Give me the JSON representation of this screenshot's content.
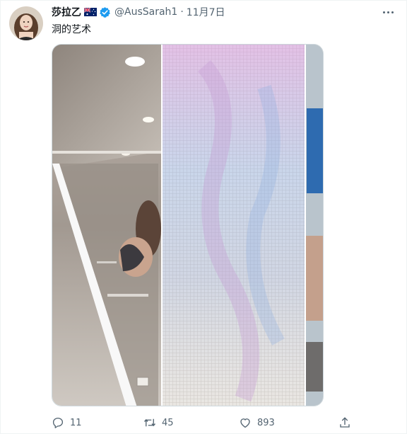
{
  "tweet": {
    "author_name": "莎拉乙",
    "handle": "@AusSarah1",
    "separator": "·",
    "timestamp": "11月7日",
    "text": "洞的艺术"
  },
  "icons": {
    "flag": "australia-flag-icon",
    "verified": "verified-badge-icon",
    "more": "more-icon",
    "reply": "reply-icon",
    "retweet": "retweet-icon",
    "like": "like-icon",
    "share": "share-icon"
  },
  "actions": {
    "reply_count": "11",
    "retweet_count": "45",
    "like_count": "893"
  },
  "colors": {
    "verified": "#1d9bf0",
    "secondary_text": "#536471"
  }
}
